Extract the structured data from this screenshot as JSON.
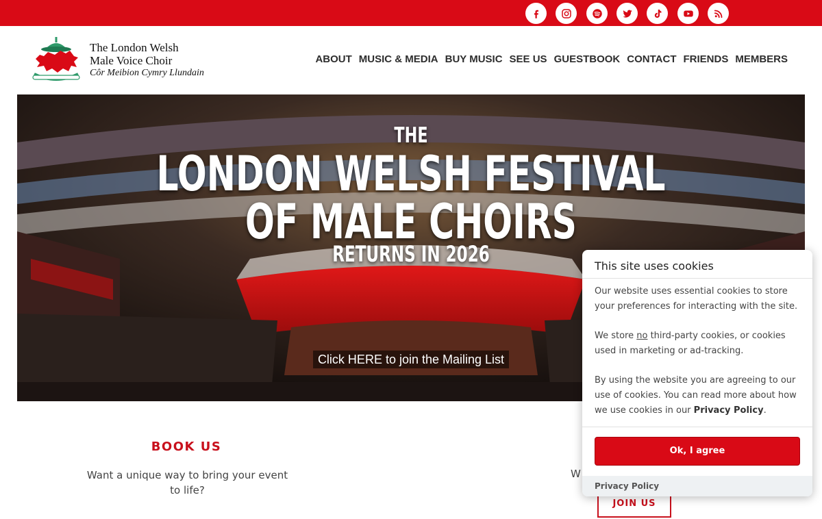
{
  "social": {
    "icons": [
      "facebook-icon",
      "instagram-icon",
      "spotify-icon",
      "twitter-icon",
      "tiktok-icon",
      "youtube-icon",
      "rss-icon"
    ]
  },
  "logo": {
    "line1": "The London Welsh",
    "line2": "Male Voice Choir",
    "line3": "Côr Meibion Cymry Llundain"
  },
  "nav": {
    "items": [
      "ABOUT",
      "MUSIC & MEDIA",
      "BUY MUSIC",
      "SEE US",
      "GUESTBOOK",
      "CONTACT",
      "FRIENDS",
      "MEMBERS"
    ]
  },
  "hero": {
    "the": "THE",
    "line1": "LONDON WELSH FESTIVAL",
    "line2": "OF MALE CHOIRS",
    "subtitle": "RETURNS IN 2026",
    "cta": "Click HERE to join the Mailing List"
  },
  "book": {
    "title": "BOOK US",
    "text": "Want a unique way to bring your event to life?"
  },
  "join": {
    "partial": "W",
    "button": "JOIN US"
  },
  "cookie": {
    "title": "This site uses cookies",
    "p1": "Our website uses essential cookies to store your preferences for interacting with the site.",
    "p2_a": "We store ",
    "p2_no": "no",
    "p2_b": " third-party cookies, or cookies used in marketing or ad-tracking.",
    "p3_a": "By using the website you are agreeing to our use of cookies. You can read more about how we use cookies in our ",
    "p3_link": "Privacy Policy",
    "p3_b": ".",
    "ok": "Ok, I agree",
    "privacy": "Privacy Policy"
  },
  "colors": {
    "brand_red": "#d90a16",
    "heading_red": "#c8101c"
  }
}
